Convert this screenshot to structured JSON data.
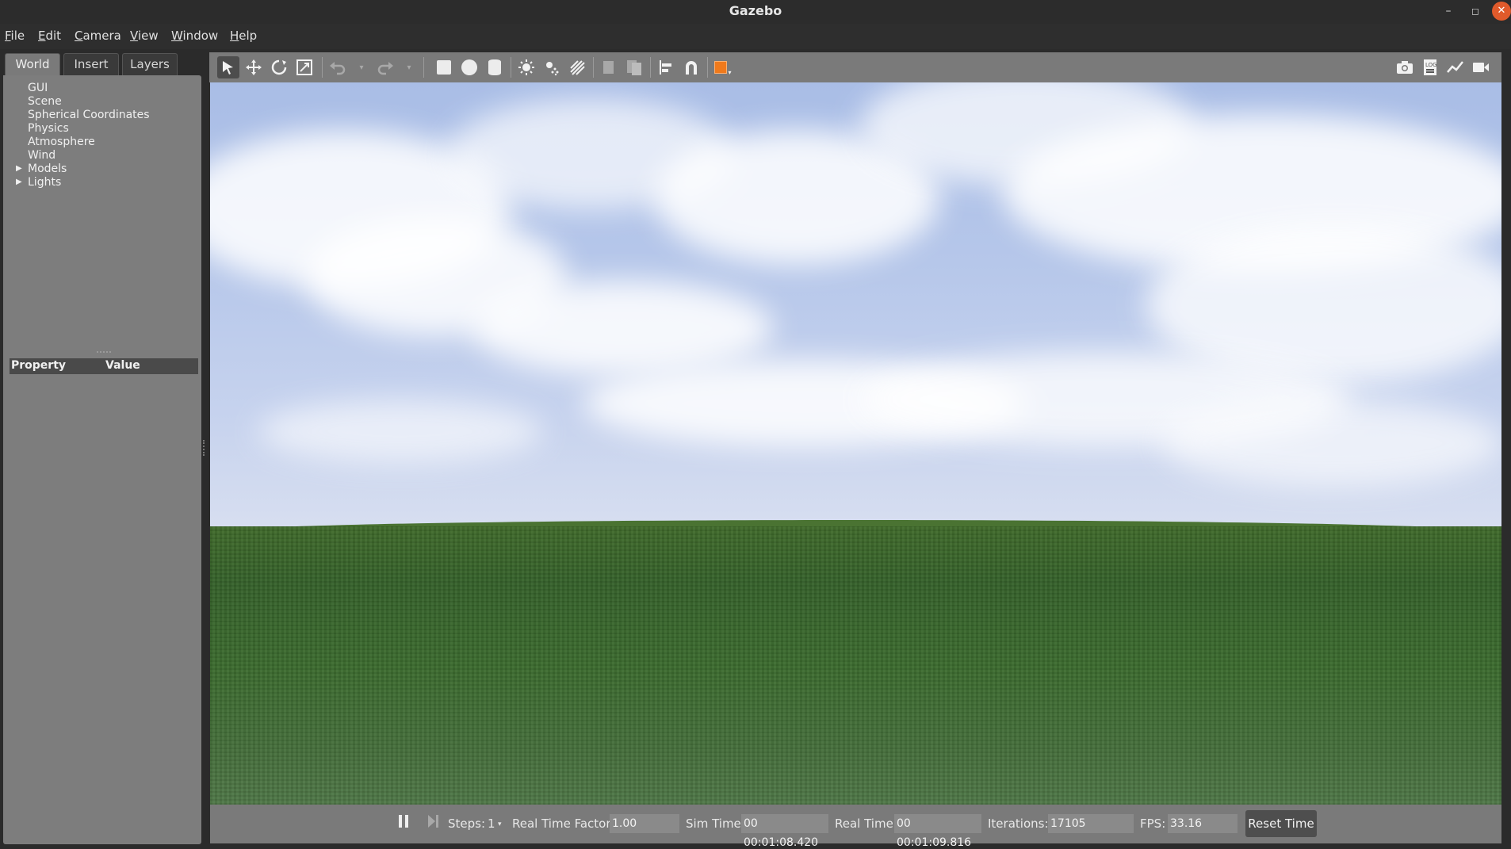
{
  "window": {
    "title": "Gazebo",
    "controls": [
      "–",
      "◻",
      "✕"
    ]
  },
  "menu": {
    "items": [
      "File",
      "Edit",
      "Camera",
      "View",
      "Window",
      "Help"
    ]
  },
  "left_panel": {
    "tabs": [
      "World",
      "Insert",
      "Layers"
    ],
    "active_tab": "World",
    "tree": [
      "GUI",
      "Scene",
      "Spherical Coordinates",
      "Physics",
      "Atmosphere",
      "Wind",
      "Models",
      "Lights"
    ],
    "expandable": [
      "Models",
      "Lights"
    ],
    "property_header": {
      "property": "Property",
      "value": "Value"
    }
  },
  "toolbar": {
    "icons": [
      "select-mode-icon",
      "translate-mode-icon",
      "rotate-mode-icon",
      "scale-mode-icon",
      "undo-icon",
      "redo-icon",
      "box-icon",
      "sphere-icon",
      "cylinder-icon",
      "point-light-icon",
      "spot-light-icon",
      "directional-light-icon",
      "copy-icon",
      "paste-icon",
      "align-icon",
      "snap-icon",
      "view-angle-icon",
      "screenshot-icon",
      "log-icon",
      "plot-icon",
      "record-video-icon"
    ],
    "active": "select-mode-icon"
  },
  "bottom": {
    "steps_label": "Steps:",
    "steps_value": "1",
    "rtf_label": "Real Time Factor:",
    "rtf_value": "1.00",
    "sim_time_label": "Sim Time:",
    "sim_time_value": "00 00:01:08.420",
    "real_time_label": "Real Time:",
    "real_time_value": "00 00:01:09.816",
    "iterations_label": "Iterations:",
    "iterations_value": "17105",
    "fps_label": "FPS:",
    "fps_value": "33.16",
    "reset_label": "Reset Time"
  },
  "colors": {
    "panel": "#7d7d7d",
    "toolbar": "#7a7a7a",
    "titlebar": "#2c2c2c",
    "close": "#e05a2b",
    "accent_orange": "#f07a1c"
  }
}
